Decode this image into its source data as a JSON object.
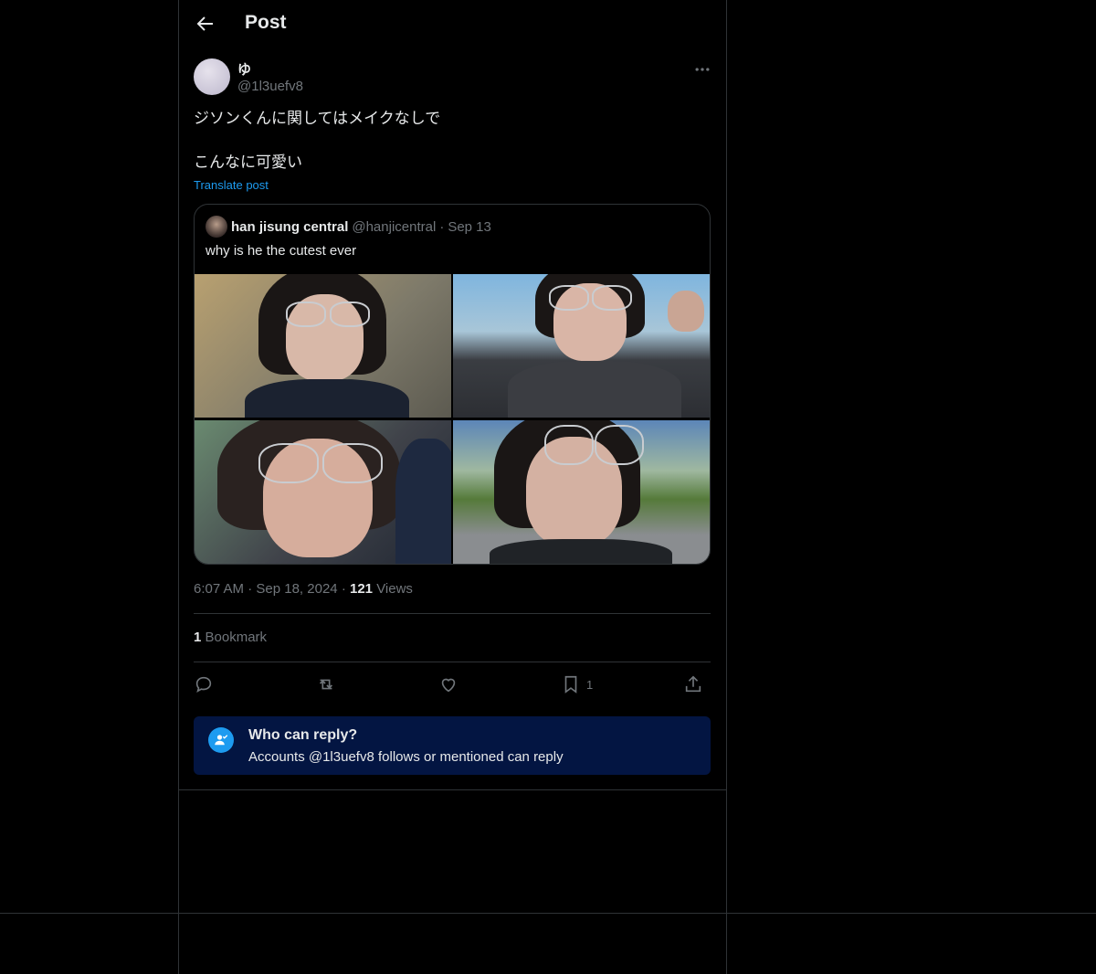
{
  "header": {
    "title": "Post"
  },
  "post": {
    "display_name": "ゆ",
    "handle": "@1l3uefv8",
    "text": "ジソンくんに関してはメイクなしで\n\nこんなに可愛い",
    "translate_label": "Translate post",
    "time": "6:07 AM",
    "sep1": "·",
    "date": "Sep 18, 2024",
    "sep2": "·",
    "views_count": "121",
    "views_label": "Views",
    "bookmarks_count": "1",
    "bookmarks_label": "Bookmark"
  },
  "quote": {
    "display_name": "han jisung central",
    "handle": "@hanjicentral",
    "dot": "·",
    "date": "Sep 13",
    "text": "why is he the cutest ever"
  },
  "actions": {
    "bookmark_count": "1"
  },
  "reply_notice": {
    "title": "Who can reply?",
    "subtitle": "Accounts @1l3uefv8 follows or mentioned can reply"
  },
  "icons": {
    "back": "arrow-left-icon",
    "more": "more-dots-icon",
    "reply": "reply-icon",
    "repost": "repost-icon",
    "like": "heart-icon",
    "bookmark": "bookmark-icon",
    "share": "share-icon",
    "reply_notice": "person-check-icon"
  },
  "colors": {
    "accent": "#1d9bf0",
    "notice_bg": "#031542",
    "border": "#2f3336",
    "muted": "#71767b"
  }
}
